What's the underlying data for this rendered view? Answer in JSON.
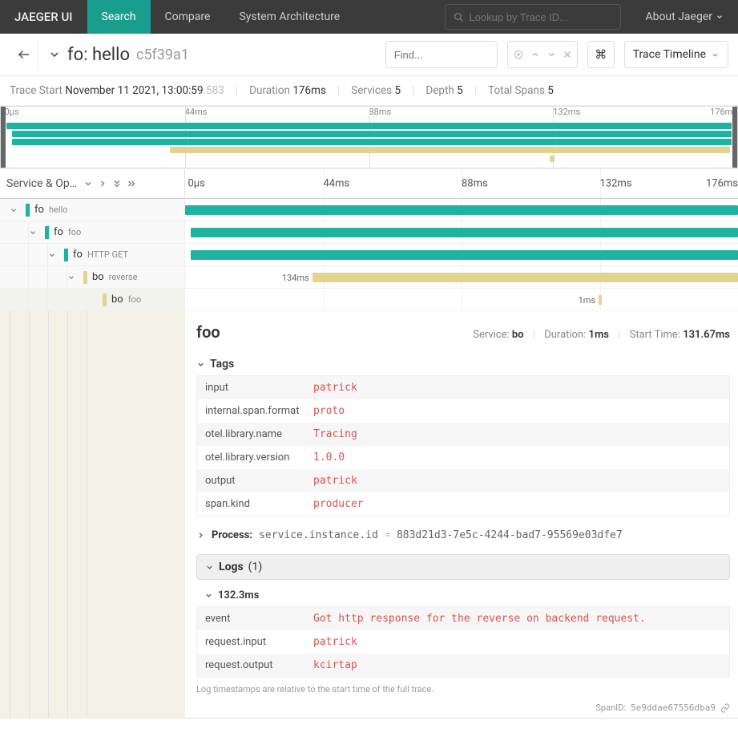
{
  "colors": {
    "teal": "#1eb2a0",
    "tan": "#e0d48e"
  },
  "nav": {
    "brand": "JAEGER UI",
    "items": [
      "Search",
      "Compare",
      "System Architecture"
    ],
    "active_index": 0,
    "search_placeholder": "Lookup by Trace ID...",
    "about": "About Jaeger"
  },
  "trace": {
    "title_prefix": "fo: hello",
    "trace_id": "c5f39a1",
    "find_placeholder": "Find...",
    "view_mode": "Trace Timeline",
    "meta": {
      "start_label": "Trace Start",
      "start_value": "November 11 2021, 13:00:59",
      "start_ms": ".583",
      "duration_label": "Duration",
      "duration_value": "176ms",
      "services_label": "Services",
      "services_value": "5",
      "depth_label": "Depth",
      "depth_value": "5",
      "spans_label": "Total Spans",
      "spans_value": "5"
    },
    "timeline_ticks": [
      "0μs",
      "44ms",
      "88ms",
      "132ms",
      "176ms"
    ],
    "column_header": "Service & Op…"
  },
  "spans": [
    {
      "service": "fo",
      "op": "hello",
      "color": "teal",
      "depth": 0,
      "start_pct": 0,
      "width_pct": 100,
      "has_children": true
    },
    {
      "service": "fo",
      "op": "foo",
      "color": "teal",
      "depth": 1,
      "start_pct": 1,
      "width_pct": 99,
      "has_children": true
    },
    {
      "service": "fo",
      "op": "HTTP GET",
      "color": "teal",
      "depth": 2,
      "start_pct": 1,
      "width_pct": 99,
      "has_children": true
    },
    {
      "service": "bo",
      "op": "reverse",
      "color": "tan",
      "depth": 3,
      "start_pct": 23,
      "width_pct": 77,
      "has_children": true,
      "label": "134ms",
      "label_side": "left"
    },
    {
      "service": "bo",
      "op": "foo",
      "color": "tan",
      "depth": 4,
      "start_pct": 74.8,
      "width_pct": 0.6,
      "has_children": false,
      "label": "1ms",
      "label_side": "left",
      "selected": true
    }
  ],
  "detail": {
    "op": "foo",
    "service_label": "Service:",
    "service": "bo",
    "duration_label": "Duration:",
    "duration": "1ms",
    "start_label": "Start Time:",
    "start": "131.67ms",
    "tags_label": "Tags",
    "tags": [
      {
        "k": "input",
        "v": "patrick"
      },
      {
        "k": "internal.span.format",
        "v": "proto"
      },
      {
        "k": "otel.library.name",
        "v": "Tracing"
      },
      {
        "k": "otel.library.version",
        "v": "1.0.0"
      },
      {
        "k": "output",
        "v": "patrick"
      },
      {
        "k": "span.kind",
        "v": "producer"
      }
    ],
    "process_label": "Process:",
    "process_key": "service.instance.id",
    "process_val": "883d21d3-7e5c-4244-bad7-95569e03dfe7",
    "logs_label": "Logs",
    "logs_count": "(1)",
    "logs": [
      {
        "time": "132.3ms",
        "rows": [
          {
            "k": "event",
            "v": "Got http response for the reverse on backend request."
          },
          {
            "k": "request.input",
            "v": "patrick"
          },
          {
            "k": "request.output",
            "v": "kcirtap"
          }
        ]
      }
    ],
    "log_footnote": "Log timestamps are relative to the start time of the full trace.",
    "span_id_label": "SpanID:",
    "span_id": "5e9ddae67556dba9"
  }
}
